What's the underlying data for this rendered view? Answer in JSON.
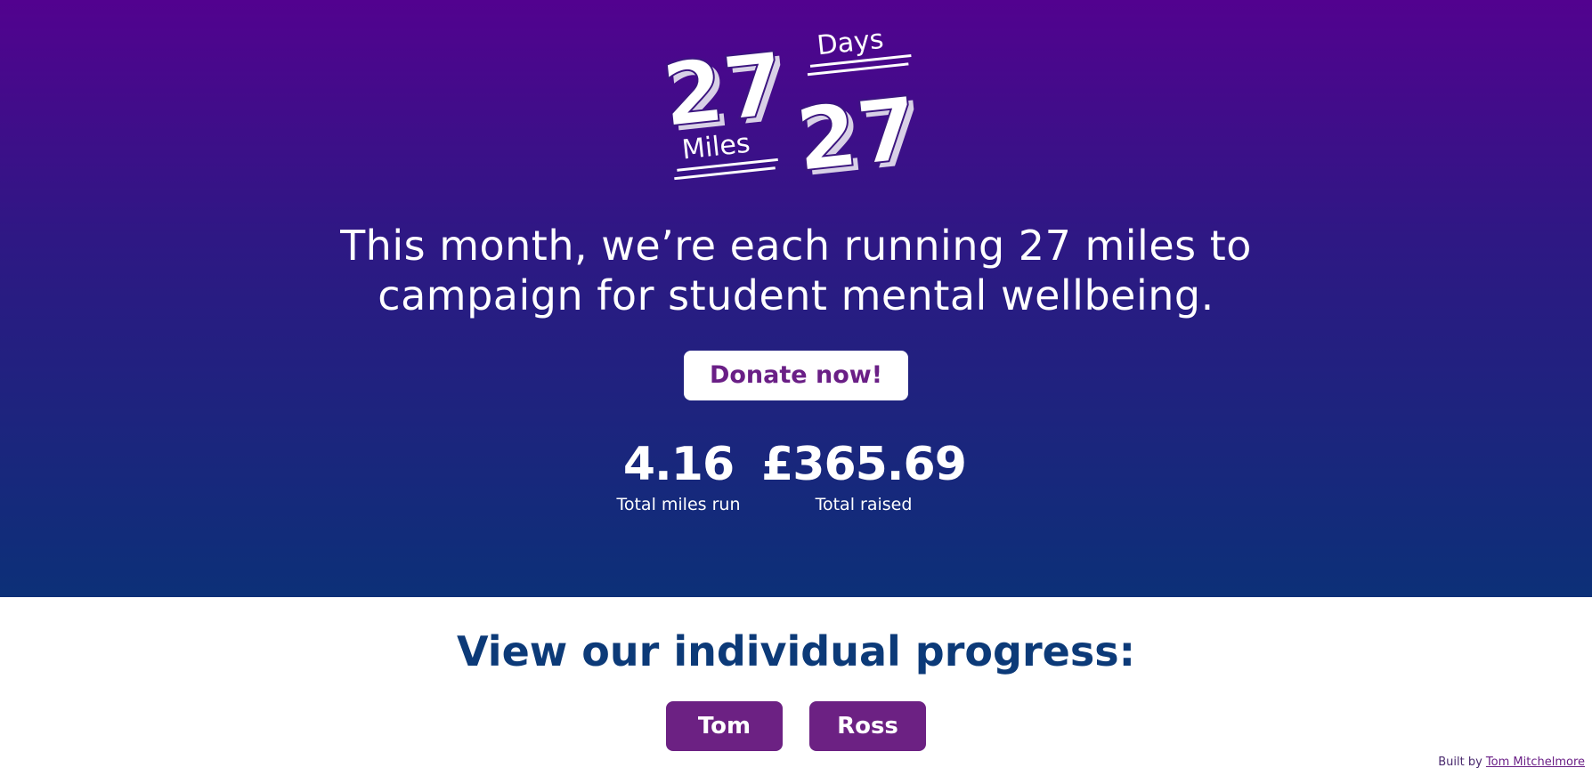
{
  "logo": {
    "miles_number": "27",
    "miles_label": "Miles",
    "days_label": "Days",
    "days_number": "27"
  },
  "hero": {
    "tagline": "This month, we’re each running 27 miles to campaign for student mental wellbeing.",
    "donate_label": "Donate now!",
    "stats": {
      "miles_value": "4.16",
      "miles_label": "Total miles run",
      "raised_value": "£365.69",
      "raised_label": "Total raised"
    }
  },
  "progress": {
    "title": "View our individual progress:",
    "people": [
      "Tom",
      "Ross"
    ]
  },
  "footer": {
    "prefix": "Built by",
    "author": "Tom Mitchelmore"
  },
  "colors": {
    "gradient_top": "#52028f",
    "gradient_bottom": "#0c3078",
    "button_purple": "#6c2183",
    "title_navy": "#0c3a78"
  }
}
